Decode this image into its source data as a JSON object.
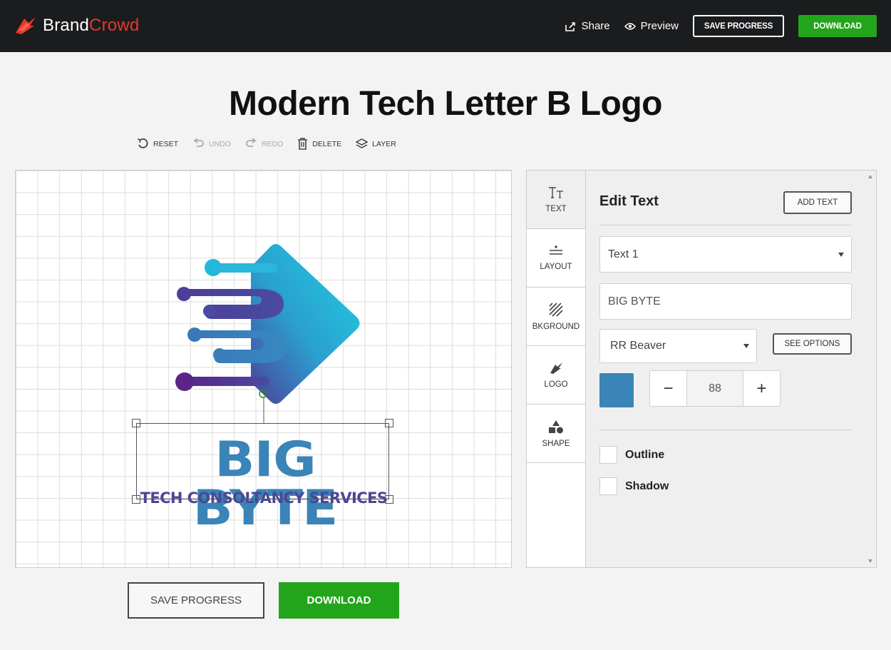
{
  "brand": {
    "part1": "Brand",
    "part2": "Crowd"
  },
  "header": {
    "share_label": "Share",
    "preview_label": "Preview",
    "save_label": "SAVE PROGRESS",
    "download_label": "DOWNLOAD"
  },
  "page_title": "Modern Tech Letter B Logo",
  "toolbar": {
    "reset": "RESET",
    "undo": "UNDO",
    "redo": "REDO",
    "delete": "DELETE",
    "layer": "LAYER"
  },
  "canvas": {
    "headline": "BIG BYTE",
    "tagline": "TECH CONSOLTANCY SERVICES",
    "text_color": "#3a84b7",
    "tagline_color": "#4c4697"
  },
  "bottom": {
    "save_label": "SAVE PROGRESS",
    "download_label": "DOWNLOAD"
  },
  "tabs": [
    {
      "label": "TEXT",
      "icon": "text-size-icon"
    },
    {
      "label": "LAYOUT",
      "icon": "layout-icon"
    },
    {
      "label": "BKGROUND",
      "icon": "background-icon"
    },
    {
      "label": "LOGO",
      "icon": "logo-icon"
    },
    {
      "label": "SHAPE",
      "icon": "shapes-icon"
    }
  ],
  "edit_text": {
    "title": "Edit Text",
    "add_text_label": "ADD TEXT",
    "layer_select": "Text 1",
    "text_value": "BIG BYTE",
    "font_select": "RR Beaver",
    "see_options_label": "SEE OPTIONS",
    "color": "#3a84b7",
    "size_value": "88",
    "minus": "−",
    "plus": "+",
    "outline_label": "Outline",
    "shadow_label": "Shadow"
  }
}
